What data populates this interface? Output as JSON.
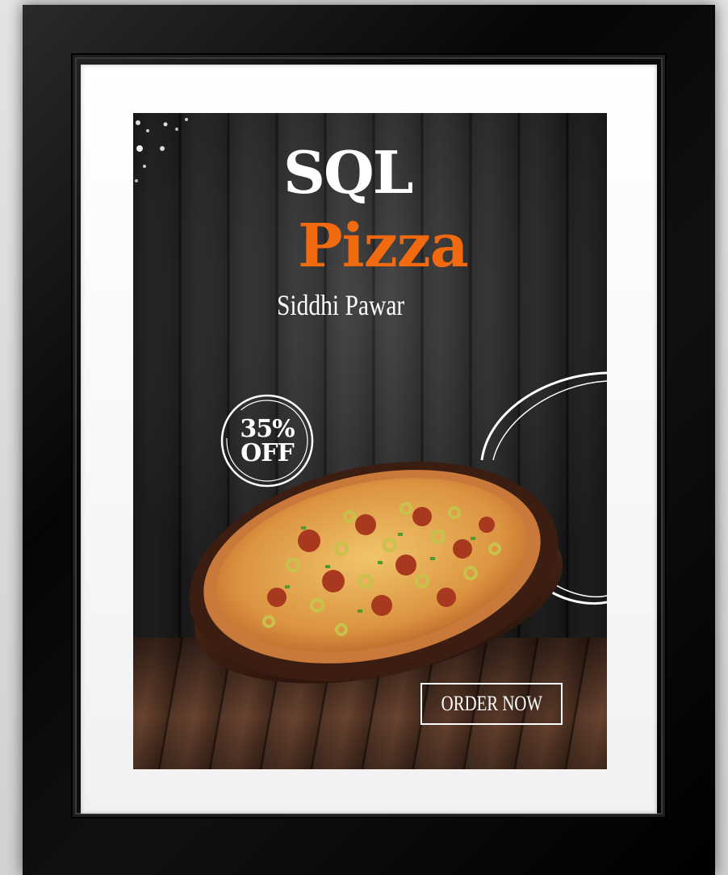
{
  "poster": {
    "brand_line1": "SQL",
    "brand_line2": "Pizza",
    "author": "Siddhi Pawar",
    "badge_percent": "35%",
    "badge_label": "OFF",
    "cta_label": "ORDER NOW"
  },
  "colors": {
    "accent": "#f26a10",
    "text": "#ffffff",
    "frame": "#000000",
    "mat": "#ffffff"
  },
  "icons": {
    "badge": "circle-badge-icon",
    "swirl": "swirl-decoration-icon",
    "pizza": "pizza-image-icon"
  }
}
